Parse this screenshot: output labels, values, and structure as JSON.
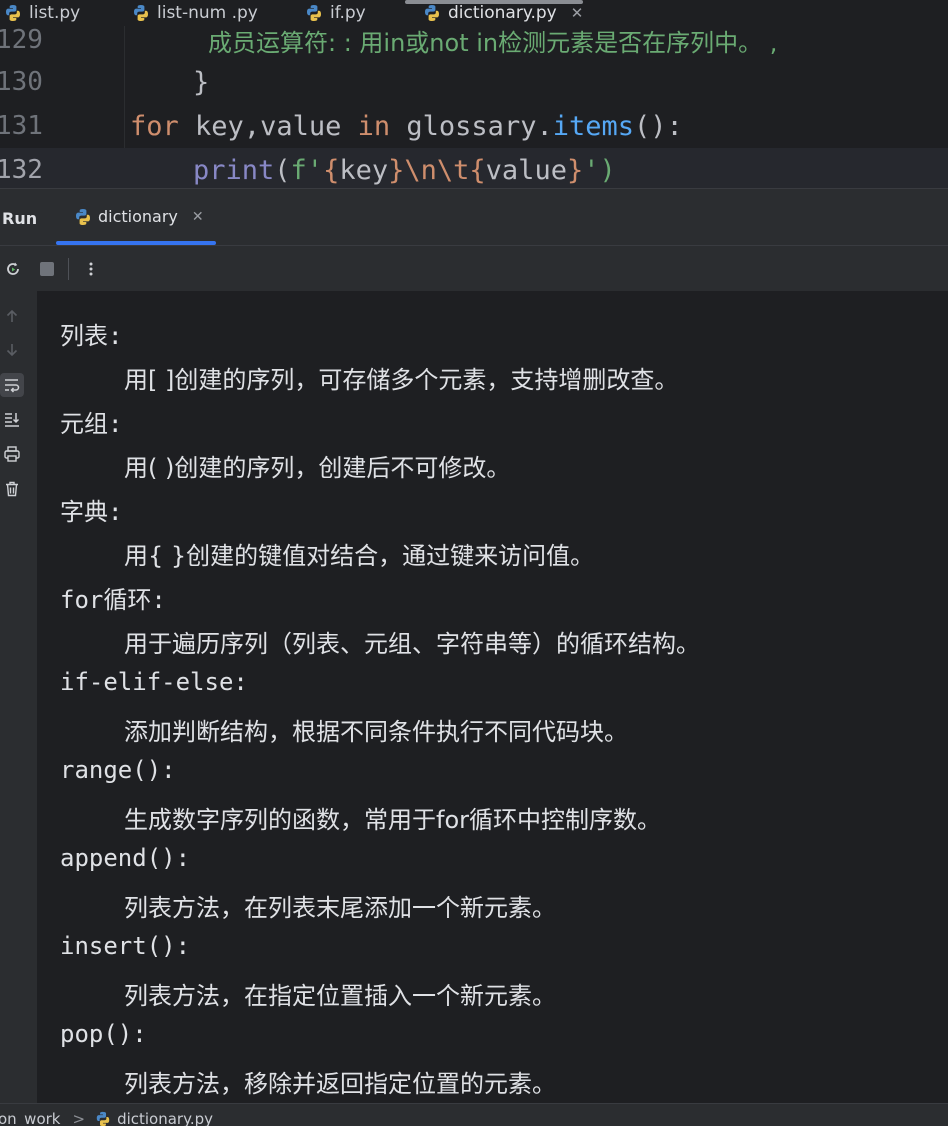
{
  "editor_tabs": [
    {
      "label": "list.py",
      "active": false
    },
    {
      "label": "list-num .py",
      "active": false
    },
    {
      "label": "if.py",
      "active": false
    },
    {
      "label": "dictionary.py",
      "active": true
    }
  ],
  "editor": {
    "line_numbers": [
      "129",
      "130",
      "131",
      "132"
    ],
    "line_129_text": "成员运算符: : 用in或not in检测元素是否在序列中。 ,",
    "line_130_text": "}",
    "line_131": {
      "kw_for": "for",
      "vars": "key,value",
      "kw_in": "in",
      "obj": "glossary",
      "method": "items",
      "tail": "():"
    },
    "line_132": {
      "fn": "print",
      "open": "(",
      "prefix": "f'",
      "lb1": "{",
      "v1": "key",
      "rb1": "}",
      "esc": "\\n\\t",
      "lb2": "{",
      "v2": "value",
      "rb2": "}",
      "close": "')"
    }
  },
  "run_panel": {
    "title": "Run",
    "tab_label": "dictionary"
  },
  "console_output": [
    {
      "text": "列表:",
      "indent": false
    },
    {
      "text": "用[ ]创建的序列，可存储多个元素，支持增删改查。",
      "indent": true
    },
    {
      "text": "元组:",
      "indent": false
    },
    {
      "text": "用( )创建的序列，创建后不可修改。",
      "indent": true
    },
    {
      "text": "字典:",
      "indent": false
    },
    {
      "text": "用{ }创建的键值对结合，通过键来访问值。",
      "indent": true
    },
    {
      "text": "for循环:",
      "indent": false
    },
    {
      "text": "用于遍历序列（列表、元组、字符串等）的循环结构。",
      "indent": true
    },
    {
      "text": "if-elif-else:",
      "indent": false
    },
    {
      "text": "添加判断结构，根据不同条件执行不同代码块。",
      "indent": true
    },
    {
      "text": "range():",
      "indent": false
    },
    {
      "text": "生成数字序列的函数，常用于for循环中控制序数。",
      "indent": true
    },
    {
      "text": "append():",
      "indent": false
    },
    {
      "text": "列表方法，在列表末尾添加一个新元素。",
      "indent": true
    },
    {
      "text": "insert():",
      "indent": false
    },
    {
      "text": "列表方法，在指定位置插入一个新元素。",
      "indent": true
    },
    {
      "text": "pop():",
      "indent": false
    },
    {
      "text": "列表方法，移除并返回指定位置的元素。",
      "indent": true
    }
  ],
  "statusbar": {
    "crumb_folder": "on_work",
    "crumb_sep": ">",
    "crumb_file": "dictionary.py"
  },
  "icons": {
    "file_type": "python-icon",
    "rerun": "rerun-icon",
    "stop": "stop-icon",
    "more": "more-vertical-icon",
    "up": "arrow-up-icon",
    "down": "arrow-down-icon",
    "soft_wrap": "soft-wrap-icon",
    "scroll_end": "scroll-to-end-icon",
    "print": "print-icon",
    "trash": "trash-icon"
  },
  "colors": {
    "accent": "#3574f0",
    "keyword": "#cf8e6d",
    "function": "#56a8f5",
    "string": "#6aab73",
    "background": "#1e1f22"
  }
}
